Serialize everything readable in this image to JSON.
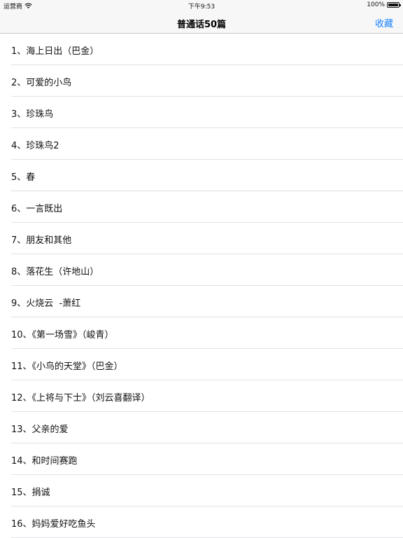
{
  "status_bar": {
    "carrier": "运营商",
    "time": "下午9:53",
    "battery_percent": "100%",
    "battery_level": 1.0
  },
  "nav": {
    "title": "普通话50篇",
    "favorites_label": "收藏"
  },
  "articles": [
    "1、海上日出（巴金）",
    "2、可爱的小鸟",
    "3、珍珠鸟",
    "4、珍珠鸟2",
    "5、春",
    "6、一言既出",
    "7、朋友和其他",
    "8、落花生（许地山）",
    "9、火烧云  -萧红",
    "10、《第一场雪》（峻青）",
    "11、《小鸟的天堂》（巴金）",
    "12、《上将与下士》（刘云喜翻译）",
    "13、父亲的爱",
    "14、和时间赛跑",
    "15、捐诚",
    "16、妈妈爱好吃鱼头"
  ],
  "colors": {
    "accent": "#1a82fb",
    "separator": "#e2e2e6",
    "bar_background": "#f7f7f7"
  }
}
